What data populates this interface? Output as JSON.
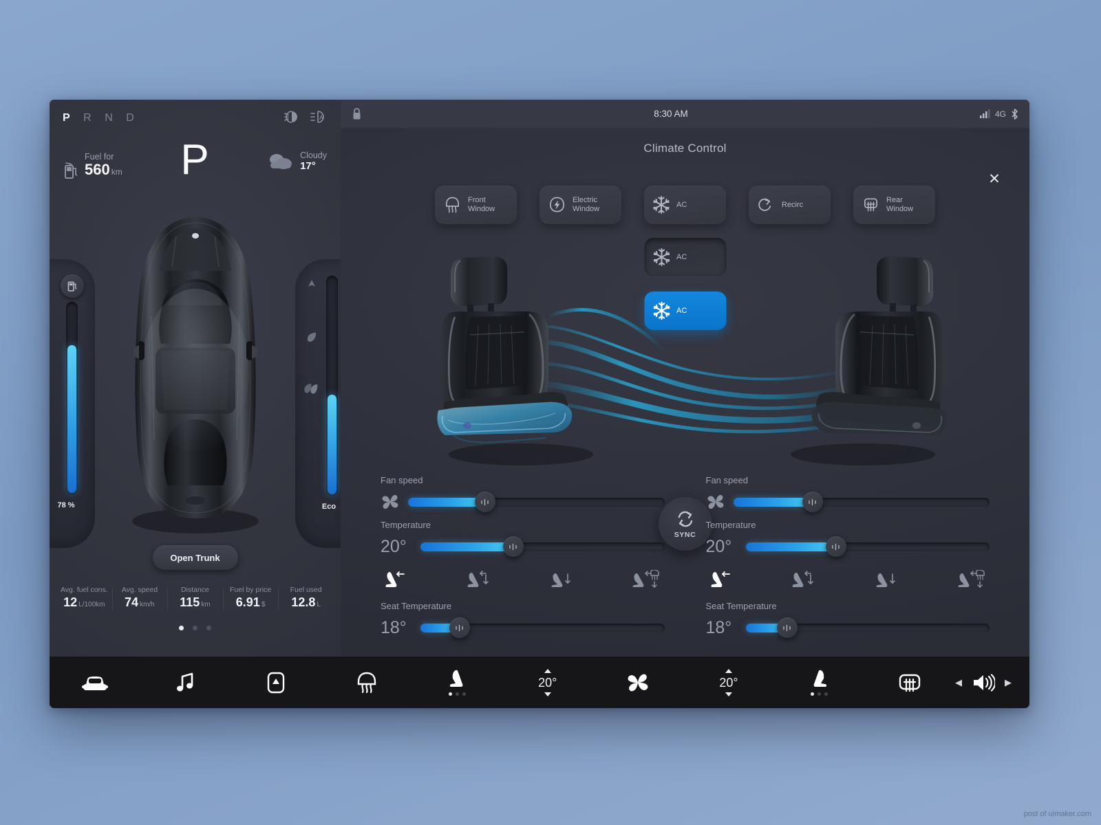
{
  "theme": {
    "accent": "#0d7fd4",
    "slider_from": "#1874d8",
    "slider_to": "#49cdf2",
    "panel_bg": "#2e303b",
    "nav_bg": "#161618"
  },
  "cluster": {
    "gears": [
      {
        "label": "P",
        "active": true
      },
      {
        "label": "R",
        "active": false
      },
      {
        "label": "N",
        "active": false
      },
      {
        "label": "D",
        "active": false
      }
    ],
    "beam_icons": [
      "low-beam-icon",
      "auto-high-beam-icon"
    ],
    "fuel_for": {
      "label": "Fuel for",
      "value": "560",
      "unit": "km",
      "icon": "fuel-pump-icon"
    },
    "gear_big": "P",
    "weather": {
      "condition": "Cloudy",
      "temp": "17°",
      "icon": "cloud-icon"
    },
    "fuel_gauge": {
      "percent": 78,
      "caption": "78 %",
      "icon": "fuel-pump-icon"
    },
    "eco_gauge": {
      "percent": 46,
      "caption": "Eco",
      "icons": [
        "power-arrow-icon",
        "leaf-icon",
        "double-leaf-icon"
      ]
    },
    "trunk_button": "Open Trunk",
    "stats": [
      {
        "key": "Avg. fuel cons.",
        "value": "12",
        "unit": "L/100km"
      },
      {
        "key": "Avg. speed",
        "value": "74",
        "unit": "km/h"
      },
      {
        "key": "Distance",
        "value": "115",
        "unit": "km"
      },
      {
        "key": "Fuel by price",
        "value": "6.91",
        "unit": "$"
      },
      {
        "key": "Fuel used",
        "value": "12.8",
        "unit": "L"
      }
    ],
    "page_dots": {
      "count": 3,
      "active": 0
    }
  },
  "statusbar": {
    "lock_icon": "lock-icon",
    "clock": "8:30 AM",
    "signal_icon": "signal-bars-icon",
    "network": "4G",
    "bluetooth_icon": "bluetooth-icon"
  },
  "climate": {
    "title": "Climate Control",
    "close_icon": "close-icon",
    "top_buttons": [
      {
        "label_line1": "Front",
        "label_line2": "Window",
        "icon": "front-defrost-icon",
        "state": "normal"
      },
      {
        "label_line1": "Electric",
        "label_line2": "Window",
        "icon": "electric-window-icon",
        "state": "normal"
      },
      {
        "label_line1": "AC",
        "label_line2": "",
        "icon": "snowflake-icon",
        "state": "normal"
      },
      {
        "label_line1": "Recirc",
        "label_line2": "",
        "icon": "recirculate-icon",
        "state": "normal"
      },
      {
        "label_line1": "Rear",
        "label_line2": "Window",
        "icon": "rear-defrost-icon",
        "state": "normal"
      }
    ],
    "ac_stack": [
      {
        "label_line1": "AC",
        "label_line2": "",
        "icon": "snowflake-icon",
        "state": "pressed"
      },
      {
        "label_line1": "AC",
        "label_line2": "",
        "icon": "snowflake-icon",
        "state": "active"
      }
    ],
    "sync": {
      "label": "SYNC",
      "icon": "sync-arrows-icon"
    },
    "zones": [
      {
        "side": "left",
        "seat_icon": "car-seat-3d-left",
        "fan": {
          "label": "Fan speed",
          "icon": "fan-icon",
          "percent": 30
        },
        "temperature": {
          "label": "Temperature",
          "value": "20°",
          "percent": 38
        },
        "airflow": [
          {
            "icon": "airflow-face-icon",
            "active": true
          },
          {
            "icon": "airflow-face-feet-icon",
            "active": false
          },
          {
            "icon": "airflow-feet-icon",
            "active": false
          },
          {
            "icon": "airflow-defrost-feet-icon",
            "active": false
          }
        ],
        "seat_temperature": {
          "label": "Seat Temperature",
          "value": "18°",
          "percent": 16
        }
      },
      {
        "side": "right",
        "seat_icon": "car-seat-3d-right",
        "fan": {
          "label": "Fan speed",
          "icon": "fan-icon",
          "percent": 31
        },
        "temperature": {
          "label": "Temperature",
          "value": "20°",
          "percent": 37
        },
        "airflow": [
          {
            "icon": "airflow-face-icon",
            "active": true
          },
          {
            "icon": "airflow-face-feet-icon",
            "active": false
          },
          {
            "icon": "airflow-feet-icon",
            "active": false
          },
          {
            "icon": "airflow-defrost-feet-icon",
            "active": false
          }
        ],
        "seat_temperature": {
          "label": "Seat Temperature",
          "value": "18°",
          "percent": 17
        }
      }
    ]
  },
  "nav": {
    "items": [
      {
        "icon": "car-icon",
        "type": "icon"
      },
      {
        "icon": "music-note-icon",
        "type": "icon"
      },
      {
        "icon": "phone-app-icon",
        "type": "icon"
      },
      {
        "icon": "front-defrost-icon",
        "type": "icon"
      },
      {
        "icon": "seat-heat-icon",
        "type": "seat",
        "dots": 3,
        "active_dot": 0
      },
      {
        "icon": "temp-stepper-left",
        "type": "stepper",
        "value": "20°"
      },
      {
        "icon": "fan-icon",
        "type": "icon"
      },
      {
        "icon": "temp-stepper-right",
        "type": "stepper",
        "value": "20°"
      },
      {
        "icon": "seat-heat-icon",
        "type": "seat",
        "dots": 3,
        "active_dot": 0
      },
      {
        "icon": "rear-defrost-icon",
        "type": "icon"
      }
    ],
    "volume": {
      "prev_icon": "prev-arrow-icon",
      "speaker_icon": "speaker-icon",
      "next_icon": "next-arrow-icon"
    }
  },
  "watermark": "post of uimaker.com"
}
